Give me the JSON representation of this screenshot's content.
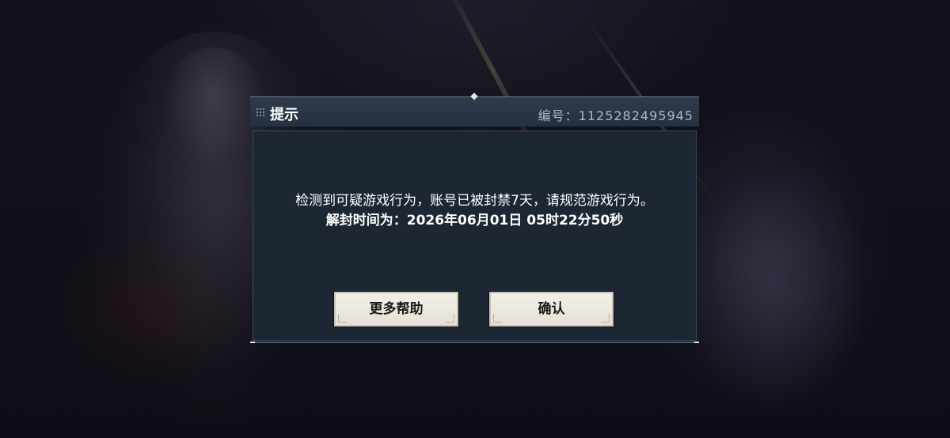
{
  "dialog": {
    "title": "提示",
    "serial_label": "编号：1125282495945",
    "message_line1": "检测到可疑游戏行为，账号已被封禁7天，请规范游戏行为。",
    "message_line2": "解封时间为：2026年06月01日 05时22分50秒",
    "buttons": {
      "help": "更多帮助",
      "confirm": "确认"
    }
  },
  "icons": {
    "grip": "drag-grip-icon",
    "ornament": "diamond-ornament-icon"
  },
  "colors": {
    "header_bg": "#2f3b4b",
    "body_bg": "#1d2734",
    "button_bg": "#f2efe8",
    "text": "#ffffff",
    "serial_text": "#aeb8c2"
  }
}
